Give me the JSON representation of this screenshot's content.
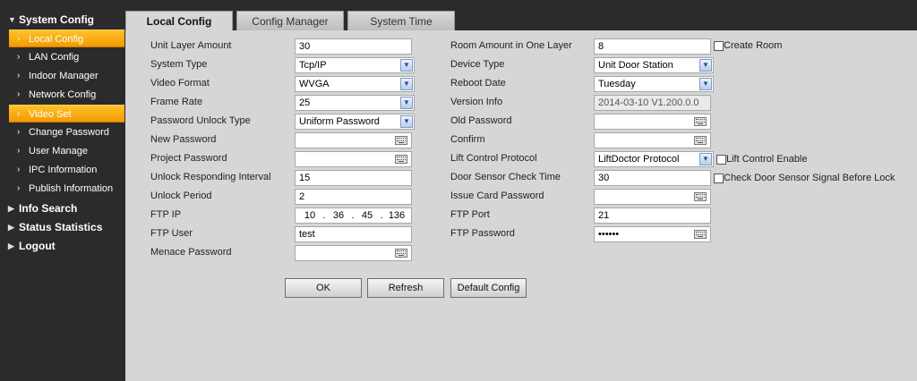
{
  "sidebar": {
    "sections": [
      {
        "label": "System Config",
        "expanded": true
      },
      {
        "label": "Info Search",
        "expanded": false
      },
      {
        "label": "Status Statistics",
        "expanded": false
      },
      {
        "label": "Logout",
        "expanded": false
      }
    ],
    "items": [
      {
        "label": "Local Config",
        "active": true
      },
      {
        "label": "LAN Config",
        "active": false
      },
      {
        "label": "Indoor Manager",
        "active": false
      },
      {
        "label": "Network Config",
        "active": false
      },
      {
        "label": "Video Set",
        "active": true
      },
      {
        "label": "Change Password",
        "active": false
      },
      {
        "label": "User Manage",
        "active": false
      },
      {
        "label": "IPC Information",
        "active": false
      },
      {
        "label": "Publish Information",
        "active": false
      }
    ]
  },
  "tabs": [
    {
      "label": "Local Config",
      "active": true
    },
    {
      "label": "Config Manager",
      "active": false
    },
    {
      "label": "System Time",
      "active": false
    }
  ],
  "left": {
    "unit_layer_amount": {
      "label": "Unit Layer Amount",
      "value": "30"
    },
    "system_type": {
      "label": "System Type",
      "value": "Tcp/IP"
    },
    "video_format": {
      "label": "Video Format",
      "value": "WVGA"
    },
    "frame_rate": {
      "label": "Frame Rate",
      "value": "25"
    },
    "password_unlock_type": {
      "label": "Password Unlock Type",
      "value": "Uniform Password"
    },
    "new_password": {
      "label": "New Password",
      "value": ""
    },
    "project_password": {
      "label": "Project Password",
      "value": ""
    },
    "unlock_responding_interval": {
      "label": "Unlock Responding Interval",
      "value": "15"
    },
    "unlock_period": {
      "label": "Unlock Period",
      "value": "2"
    },
    "ftp_ip": {
      "label": "FTP IP",
      "octets": [
        "10",
        "36",
        "45",
        "136"
      ],
      "dot": "."
    },
    "ftp_user": {
      "label": "FTP User",
      "value": "test"
    },
    "menace_password": {
      "label": "Menace Password",
      "value": ""
    }
  },
  "right": {
    "room_amount": {
      "label": "Room Amount in One Layer",
      "value": "8"
    },
    "create_room": {
      "label": "Create Room",
      "checked": false
    },
    "device_type": {
      "label": "Device Type",
      "value": "Unit Door Station"
    },
    "reboot_date": {
      "label": "Reboot Date",
      "value": "Tuesday"
    },
    "version_info": {
      "label": "Version Info",
      "value": "2014-03-10 V1.200.0.0"
    },
    "old_password": {
      "label": "Old Password",
      "value": ""
    },
    "confirm": {
      "label": "Confirm",
      "value": ""
    },
    "lift_control_protocol": {
      "label": "Lift Control Protocol",
      "value": "LiftDoctor Protocol"
    },
    "lift_control_enable": {
      "label": "Lift Control Enable",
      "checked": false
    },
    "door_sensor_check_time": {
      "label": "Door Sensor Check Time",
      "value": "30"
    },
    "check_door_sensor": {
      "label": "Check Door Sensor Signal Before Lock",
      "checked": false
    },
    "issue_card_password": {
      "label": "Issue Card Password",
      "value": ""
    },
    "ftp_port": {
      "label": "FTP Port",
      "value": "21"
    },
    "ftp_password": {
      "label": "FTP Password",
      "value": "••••••"
    }
  },
  "buttons": {
    "ok": "OK",
    "refresh": "Refresh",
    "default_config": "Default Config"
  },
  "icons": {
    "dropdown": "chevron-down-icon",
    "keyboard": "keyboard-icon",
    "expanded": "triangle-down-icon",
    "collapsed": "triangle-right-icon",
    "item": "chevron-right-icon"
  },
  "colors": {
    "active_item": "#f5a300",
    "sidebar_bg": "#2b2b2b",
    "content_bg": "#d6d6d6"
  }
}
